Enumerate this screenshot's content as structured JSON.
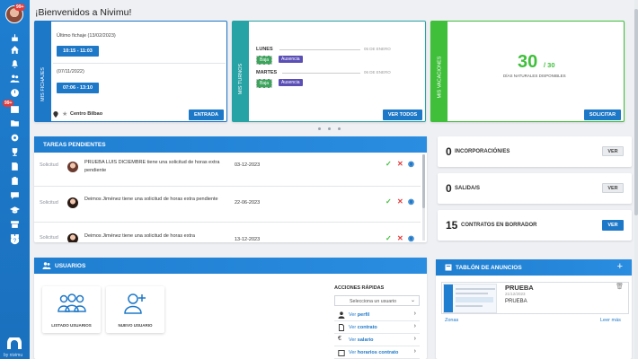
{
  "sidebar": {
    "avatar_badge": "99+",
    "notif_badge": "99+",
    "logo_text": "by nivimu",
    "icons": [
      "cake-icon",
      "home-icon",
      "bell-icon",
      "users-icon",
      "clock-icon",
      "calendar-icon",
      "folder-icon",
      "gear-icon",
      "trophy-icon",
      "document-icon",
      "clipboard-icon",
      "chat-icon",
      "graduation-icon",
      "store-icon",
      "grid-icon",
      "help-icon"
    ]
  },
  "header": {
    "title": "¡Bienvenidos a Nivimu!"
  },
  "fichajes": {
    "tab_label": "MIS FICHAJES",
    "last_label": "Último fichaje (13/02/2023)",
    "range1": "10:15 - 11:03",
    "date2": "(07/11/2022)",
    "range2": "07:06 - 13:10",
    "location": "Centro Bilbao",
    "button": "ENTRADA"
  },
  "turnos": {
    "tab_label": "MIS TURNOS",
    "day1": "LUNES",
    "date1": "05 DE ENERO",
    "day2": "MARTES",
    "date2": "06 DE ENERO",
    "tag_gray": "Baja",
    "tag_purple": "Ausencia",
    "button": "VER TODOS"
  },
  "vacaciones": {
    "tab_label": "MIS VACACIONES",
    "available": "30",
    "total": "/ 30",
    "caption": "DÍAS NATURALES DISPONIBLES",
    "button": "SOLICITAR"
  },
  "tareas": {
    "title": "TAREAS PENDIENTES",
    "rows": [
      {
        "label": "Solicitud",
        "text": "PRUEBA LUIS DICIEMBRE tiene una solicitud de horas extra pendiente",
        "date": "03-12-2023"
      },
      {
        "label": "Solicitud",
        "text": "Deimos Jiménez tiene una solicitud de horas extra pendiente",
        "date": "22-06-2023"
      },
      {
        "label": "Solicitud",
        "text": "Deimos Jiménez tiene una solicitud de horas extra",
        "date": "13-12-2023"
      }
    ]
  },
  "stats": [
    {
      "value": "0",
      "label": "INCORPORACIÓN/ES",
      "button": "VER"
    },
    {
      "value": "0",
      "label": "SALIDA/S",
      "button": "VER"
    },
    {
      "value": "15",
      "label": "CONTRATOS EN BORRADOR",
      "button": "VER"
    }
  ],
  "usuarios": {
    "title": "USUARIOS",
    "tile1": "LISTADO USUARIOS",
    "tile2": "NUEVO USUARIO",
    "qa_title": "ACCIONES RÁPIDAS",
    "select_placeholder": "Selecciona un usuario",
    "actions": [
      {
        "pre": "Ver ",
        "bold": "perfil"
      },
      {
        "pre": "Ver ",
        "bold": "contrato"
      },
      {
        "pre": "Ver ",
        "bold": "salario"
      },
      {
        "pre": "Ver ",
        "bold": "horarios contrato"
      }
    ]
  },
  "tablon": {
    "title": "TABLÓN DE ANUNCIOS",
    "post_title": "PRUEBA",
    "post_date": "21/12/2023",
    "post_body": "PRUEBA",
    "zone_link": "Zonas",
    "more_link": "Leer más"
  },
  "colors": {
    "primary": "#1e78c8",
    "green": "#3fbf3a",
    "teal": "#27a3a6",
    "purple": "#5b4fb6",
    "red": "#e23b3b"
  }
}
